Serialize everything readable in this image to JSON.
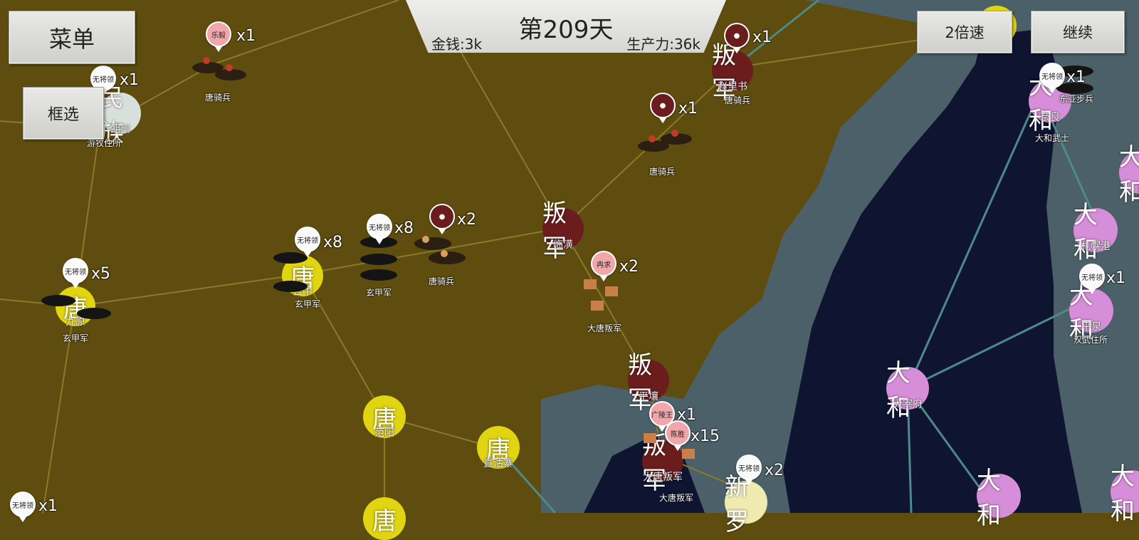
{
  "ui": {
    "menu_label": "菜单",
    "select_label": "框选",
    "speed_label": "2倍速",
    "continue_label": "继续",
    "day_label": "第209天",
    "money_label": "金钱:3k",
    "productivity_label": "生产力:36k"
  },
  "colors": {
    "land": "#5e4d0f",
    "coast": "#4b6068",
    "sea": "#0f1530",
    "tang": "#e1d411",
    "rebel": "#6b1d1d",
    "yamato": "#d78ed8",
    "silla": "#efeab0",
    "pin_pink": "#f1a7aa",
    "route": "#8a7a2a",
    "sea_route": "#4e8a8a"
  },
  "cities": [
    {
      "faction": "唐",
      "label": "九原"
    },
    {
      "faction": "唐",
      "label": "云中"
    },
    {
      "faction": "唐",
      "label": "范阳"
    },
    {
      "faction": "唐",
      "label": "卢龙"
    },
    {
      "faction": "唐",
      "label": "直沽寨"
    },
    {
      "faction": "唐",
      "label": ""
    },
    {
      "faction": "叛军",
      "label": "临潢"
    },
    {
      "faction": "叛军",
      "label": "赵里书"
    },
    {
      "faction": "叛军",
      "label": "平壤"
    },
    {
      "faction": "叛军",
      "label": "大唐叛军"
    },
    {
      "faction": "新罗",
      "label": ""
    },
    {
      "faction": "民族",
      "label": "胡州"
    },
    {
      "faction": "大和",
      "label": "大宰府"
    },
    {
      "faction": "大和",
      "label": "札幌港"
    },
    {
      "faction": "大和",
      "label": "平泉"
    },
    {
      "faction": "大和",
      "label": "奈良"
    },
    {
      "faction": "大和",
      "label": ""
    },
    {
      "faction": "大和",
      "label": ""
    },
    {
      "faction": "大和",
      "label": "札"
    }
  ],
  "units": [
    {
      "general": "乐毅",
      "count": "x1",
      "type": "唐骑兵"
    },
    {
      "general": "无将领",
      "count": "x1",
      "type": "游牧住所"
    },
    {
      "general": "",
      "count": "x1",
      "type": "唐骑兵"
    },
    {
      "general": "",
      "count": "x1",
      "type": "唐骑兵"
    },
    {
      "general": "无将领",
      "count": "x5",
      "type": "玄甲军"
    },
    {
      "general": "无将领",
      "count": "x8",
      "type": "玄甲军"
    },
    {
      "general": "无将领",
      "count": "x8",
      "type": "玄甲军"
    },
    {
      "general": "",
      "count": "x2",
      "type": "唐骑兵"
    },
    {
      "general": "冉求",
      "count": "x2",
      "type": "大唐叛军"
    },
    {
      "general": "广陵王",
      "count": "x1",
      "type": ""
    },
    {
      "general": "陈胜",
      "count": "x15",
      "type": "大唐叛军"
    },
    {
      "general": "无将领",
      "count": "x2",
      "type": ""
    },
    {
      "general": "无将领",
      "count": "x1",
      "type": "东亚步兵"
    },
    {
      "general": "无将领",
      "count": "x1",
      "type": "大和武士"
    },
    {
      "general": "无将领",
      "count": "x1",
      "type": "汉武住所"
    },
    {
      "general": "无将领",
      "count": "x1",
      "type": ""
    }
  ]
}
